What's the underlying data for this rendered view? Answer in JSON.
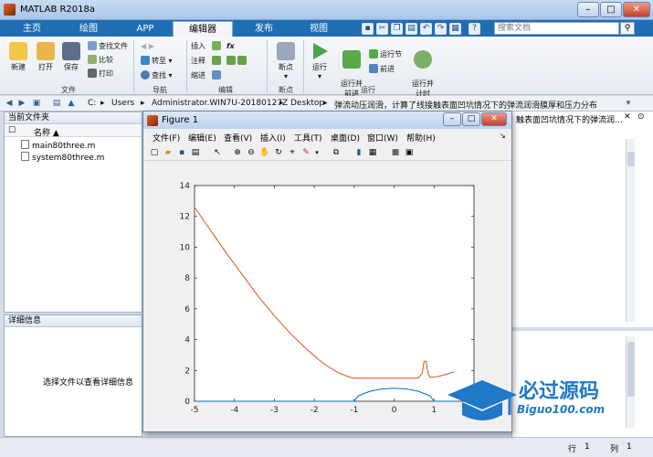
{
  "window": {
    "title": "MATLAB R2018a"
  },
  "tabs": [
    {
      "label": "主页"
    },
    {
      "label": "绘图"
    },
    {
      "label": "APP"
    },
    {
      "label": "编辑器"
    },
    {
      "label": "发布"
    },
    {
      "label": "视图"
    }
  ],
  "search": {
    "placeholder": "搜索文档"
  },
  "ribbon": {
    "file": {
      "new_label": "新建",
      "open_label": "打开",
      "save_label": "保存",
      "find_files_label": "查找文件",
      "compare_label": "比较",
      "print_label": "打印",
      "group_label": "文件"
    },
    "navigate": {
      "goto_label": "转至",
      "find_label": "查找",
      "group_label": "导航"
    },
    "edit": {
      "insert_label": "插入",
      "comment_label": "注释",
      "indent_label": "缩进",
      "fx_label": "fx",
      "group_label": "编辑"
    },
    "breakpoints": {
      "breakpoints_label": "断点",
      "group_label": "断点"
    },
    "run": {
      "run_label": "运行",
      "run_advance_label": "运行并\n前进",
      "run_section_label": "运行节",
      "advance_label": "前进",
      "run_time_label": "运行并\n计时",
      "group_label": "运行"
    }
  },
  "address": {
    "segments": [
      "C:",
      "Users",
      "Administrator.WIN7U-20180127Z",
      "Desktop",
      "弹流动压润滑，计算了线接触表面凹坑情况下的弹流润滑膜厚和压力分布"
    ]
  },
  "current_folder": {
    "title": "当前文件夹",
    "name_column": "名称 ▲",
    "files": [
      {
        "name": "main80three.m"
      },
      {
        "name": "system80three.m"
      }
    ]
  },
  "details": {
    "title": "详细信息",
    "empty_text": "选择文件以查看详细信息"
  },
  "editor_tab_partial": "触表面凹坑情况下的弹流润...",
  "figure": {
    "title": "Figure 1",
    "menu": [
      "文件(F)",
      "编辑(E)",
      "查看(V)",
      "插入(I)",
      "工具(T)",
      "桌面(D)",
      "窗口(W)",
      "帮助(H)"
    ]
  },
  "chart_data": {
    "type": "line",
    "xlim": [
      -5,
      2
    ],
    "ylim": [
      0,
      14
    ],
    "xticks": [
      -5,
      -4,
      -3,
      -2,
      -1,
      0,
      1
    ],
    "yticks": [
      0,
      2,
      4,
      6,
      8,
      10,
      12,
      14
    ],
    "grid": false,
    "series": [
      {
        "color": "#d95319",
        "x": [
          -5.0,
          -4.6,
          -4.2,
          -3.8,
          -3.4,
          -3.0,
          -2.6,
          -2.2,
          -1.8,
          -1.4,
          -1.1,
          -1.0,
          0.0,
          0.6,
          0.7,
          0.75,
          0.8,
          0.85,
          0.9,
          1.1,
          1.5
        ],
        "y": [
          12.6,
          11.1,
          9.6,
          8.2,
          6.8,
          5.55,
          4.4,
          3.4,
          2.5,
          1.85,
          1.55,
          1.5,
          1.5,
          1.5,
          1.8,
          2.6,
          2.6,
          1.8,
          1.55,
          1.6,
          1.9
        ]
      },
      {
        "color": "#0072bd",
        "x": [
          -5.0,
          -1.0,
          -0.9,
          -0.6,
          -0.3,
          0.0,
          0.3,
          0.6,
          0.9,
          1.0,
          1.5
        ],
        "y": [
          0,
          0,
          0.35,
          0.65,
          0.8,
          0.85,
          0.8,
          0.65,
          0.35,
          0,
          0
        ]
      }
    ]
  },
  "status": {
    "row_label": "行",
    "row_value": "1",
    "col_label": "列",
    "col_value": "1"
  },
  "watermark": {
    "cn": "必过源码",
    "url": "Biguo100.com"
  },
  "colors": {
    "ribbon_tab": "#1f6eb3",
    "accent": "#1f78c8"
  }
}
